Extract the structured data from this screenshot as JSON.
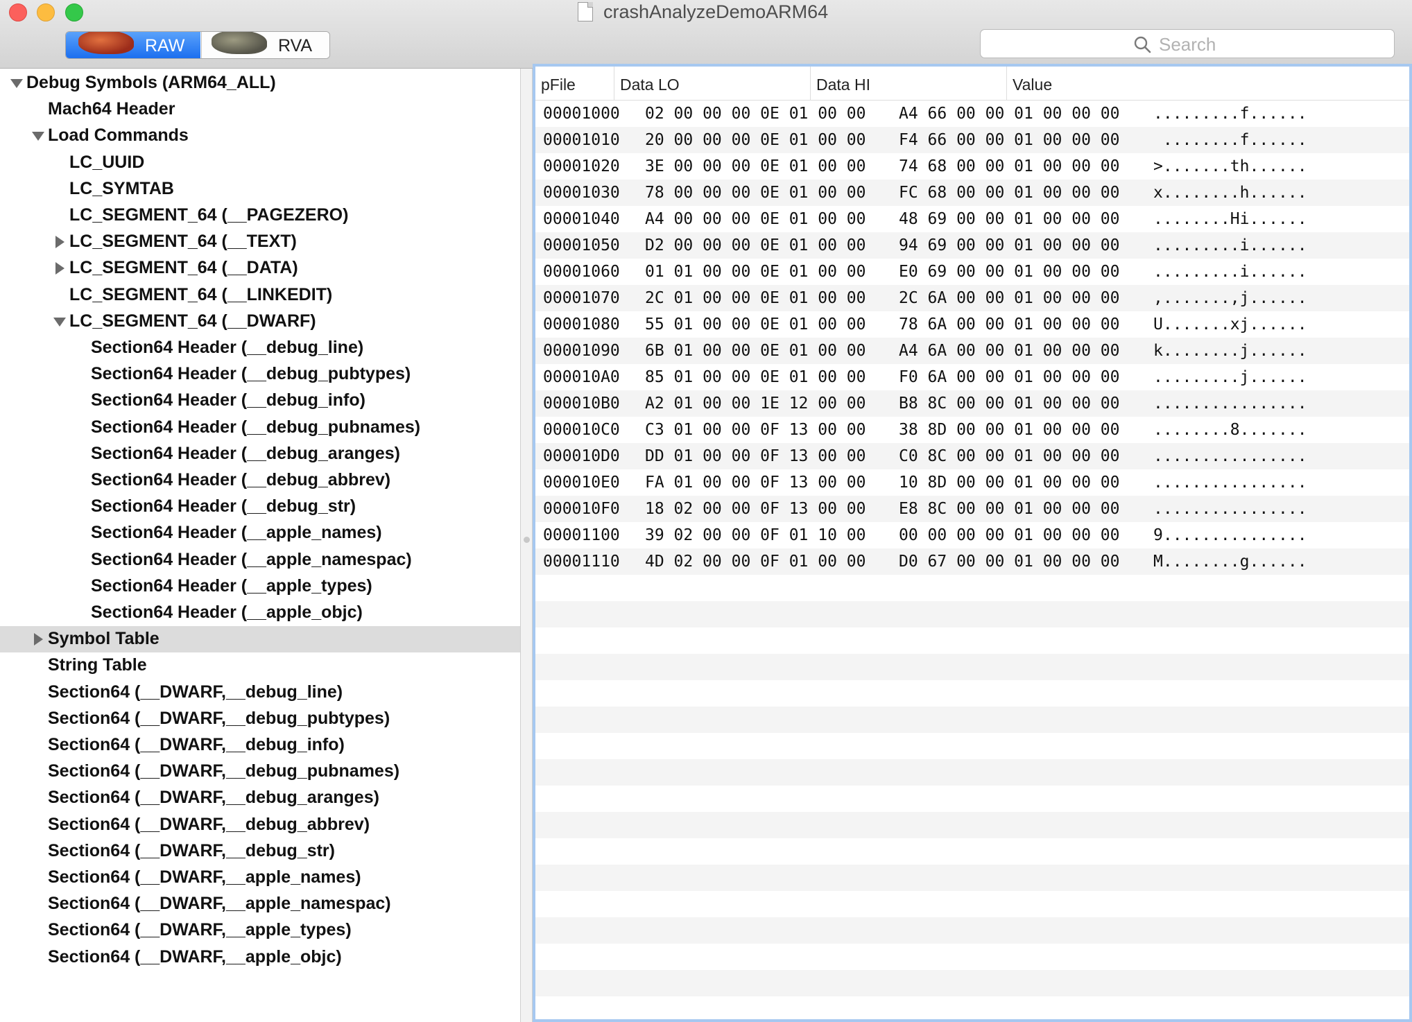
{
  "window": {
    "title": "crashAnalyzeDemoARM64"
  },
  "toolbar": {
    "segments": [
      {
        "label": "RAW",
        "icon": "raw-mode-icon",
        "selected": true
      },
      {
        "label": "RVA",
        "icon": "rva-mode-icon",
        "selected": false
      }
    ],
    "search_placeholder": "Search"
  },
  "colors": {
    "accent": "#1c6fef",
    "selection": "#dcdcdc",
    "focus_ring": "#a6c8f0"
  },
  "tree": [
    {
      "label": "Debug Symbols (ARM64_ALL)",
      "level": 0,
      "arrow": "down"
    },
    {
      "label": "Mach64 Header",
      "level": 1,
      "arrow": "none"
    },
    {
      "label": "Load Commands",
      "level": 1,
      "arrow": "down"
    },
    {
      "label": "LC_UUID",
      "level": 2,
      "arrow": "none"
    },
    {
      "label": "LC_SYMTAB",
      "level": 2,
      "arrow": "none"
    },
    {
      "label": "LC_SEGMENT_64 (__PAGEZERO)",
      "level": 2,
      "arrow": "none"
    },
    {
      "label": "LC_SEGMENT_64 (__TEXT)",
      "level": 2,
      "arrow": "right"
    },
    {
      "label": "LC_SEGMENT_64 (__DATA)",
      "level": 2,
      "arrow": "right"
    },
    {
      "label": "LC_SEGMENT_64 (__LINKEDIT)",
      "level": 2,
      "arrow": "none"
    },
    {
      "label": "LC_SEGMENT_64 (__DWARF)",
      "level": 2,
      "arrow": "down"
    },
    {
      "label": "Section64 Header (__debug_line)",
      "level": 3,
      "arrow": "none"
    },
    {
      "label": "Section64 Header (__debug_pubtypes)",
      "level": 3,
      "arrow": "none"
    },
    {
      "label": "Section64 Header (__debug_info)",
      "level": 3,
      "arrow": "none"
    },
    {
      "label": "Section64 Header (__debug_pubnames)",
      "level": 3,
      "arrow": "none"
    },
    {
      "label": "Section64 Header (__debug_aranges)",
      "level": 3,
      "arrow": "none"
    },
    {
      "label": "Section64 Header (__debug_abbrev)",
      "level": 3,
      "arrow": "none"
    },
    {
      "label": "Section64 Header (__debug_str)",
      "level": 3,
      "arrow": "none"
    },
    {
      "label": "Section64 Header (__apple_names)",
      "level": 3,
      "arrow": "none"
    },
    {
      "label": "Section64 Header (__apple_namespac)",
      "level": 3,
      "arrow": "none"
    },
    {
      "label": "Section64 Header (__apple_types)",
      "level": 3,
      "arrow": "none"
    },
    {
      "label": "Section64 Header (__apple_objc)",
      "level": 3,
      "arrow": "none"
    },
    {
      "label": "Symbol Table",
      "level": 1,
      "arrow": "right",
      "selected": true
    },
    {
      "label": "String Table",
      "level": 1,
      "arrow": "none"
    },
    {
      "label": "Section64 (__DWARF,__debug_line)",
      "level": 1,
      "arrow": "none"
    },
    {
      "label": "Section64 (__DWARF,__debug_pubtypes)",
      "level": 1,
      "arrow": "none"
    },
    {
      "label": "Section64 (__DWARF,__debug_info)",
      "level": 1,
      "arrow": "none"
    },
    {
      "label": "Section64 (__DWARF,__debug_pubnames)",
      "level": 1,
      "arrow": "none"
    },
    {
      "label": "Section64 (__DWARF,__debug_aranges)",
      "level": 1,
      "arrow": "none"
    },
    {
      "label": "Section64 (__DWARF,__debug_abbrev)",
      "level": 1,
      "arrow": "none"
    },
    {
      "label": "Section64 (__DWARF,__debug_str)",
      "level": 1,
      "arrow": "none"
    },
    {
      "label": "Section64 (__DWARF,__apple_names)",
      "level": 1,
      "arrow": "none"
    },
    {
      "label": "Section64 (__DWARF,__apple_namespac)",
      "level": 1,
      "arrow": "none"
    },
    {
      "label": "Section64 (__DWARF,__apple_types)",
      "level": 1,
      "arrow": "none"
    },
    {
      "label": "Section64 (__DWARF,__apple_objc)",
      "level": 1,
      "arrow": "none"
    }
  ],
  "table": {
    "columns": [
      "pFile",
      "Data LO",
      "Data HI",
      "Value"
    ],
    "rows": [
      [
        "00001000",
        "02 00 00 00 0E 01 00 00",
        "A4 66 00 00 01 00 00 00",
        ".........f......"
      ],
      [
        "00001010",
        "20 00 00 00 0E 01 00 00",
        "F4 66 00 00 01 00 00 00",
        " ........f......"
      ],
      [
        "00001020",
        "3E 00 00 00 0E 01 00 00",
        "74 68 00 00 01 00 00 00",
        ">.......th......"
      ],
      [
        "00001030",
        "78 00 00 00 0E 01 00 00",
        "FC 68 00 00 01 00 00 00",
        "x........h......"
      ],
      [
        "00001040",
        "A4 00 00 00 0E 01 00 00",
        "48 69 00 00 01 00 00 00",
        "........Hi......"
      ],
      [
        "00001050",
        "D2 00 00 00 0E 01 00 00",
        "94 69 00 00 01 00 00 00",
        ".........i......"
      ],
      [
        "00001060",
        "01 01 00 00 0E 01 00 00",
        "E0 69 00 00 01 00 00 00",
        ".........i......"
      ],
      [
        "00001070",
        "2C 01 00 00 0E 01 00 00",
        "2C 6A 00 00 01 00 00 00",
        ",.......,j......"
      ],
      [
        "00001080",
        "55 01 00 00 0E 01 00 00",
        "78 6A 00 00 01 00 00 00",
        "U.......xj......"
      ],
      [
        "00001090",
        "6B 01 00 00 0E 01 00 00",
        "A4 6A 00 00 01 00 00 00",
        "k........j......"
      ],
      [
        "000010A0",
        "85 01 00 00 0E 01 00 00",
        "F0 6A 00 00 01 00 00 00",
        ".........j......"
      ],
      [
        "000010B0",
        "A2 01 00 00 1E 12 00 00",
        "B8 8C 00 00 01 00 00 00",
        "................"
      ],
      [
        "000010C0",
        "C3 01 00 00 0F 13 00 00",
        "38 8D 00 00 01 00 00 00",
        "........8......."
      ],
      [
        "000010D0",
        "DD 01 00 00 0F 13 00 00",
        "C0 8C 00 00 01 00 00 00",
        "................"
      ],
      [
        "000010E0",
        "FA 01 00 00 0F 13 00 00",
        "10 8D 00 00 01 00 00 00",
        "................"
      ],
      [
        "000010F0",
        "18 02 00 00 0F 13 00 00",
        "E8 8C 00 00 01 00 00 00",
        "................"
      ],
      [
        "00001100",
        "39 02 00 00 0F 01 10 00",
        "00 00 00 00 01 00 00 00",
        "9..............."
      ],
      [
        "00001110",
        "4D 02 00 00 0F 01 00 00",
        "D0 67 00 00 01 00 00 00",
        "M........g......"
      ]
    ]
  }
}
